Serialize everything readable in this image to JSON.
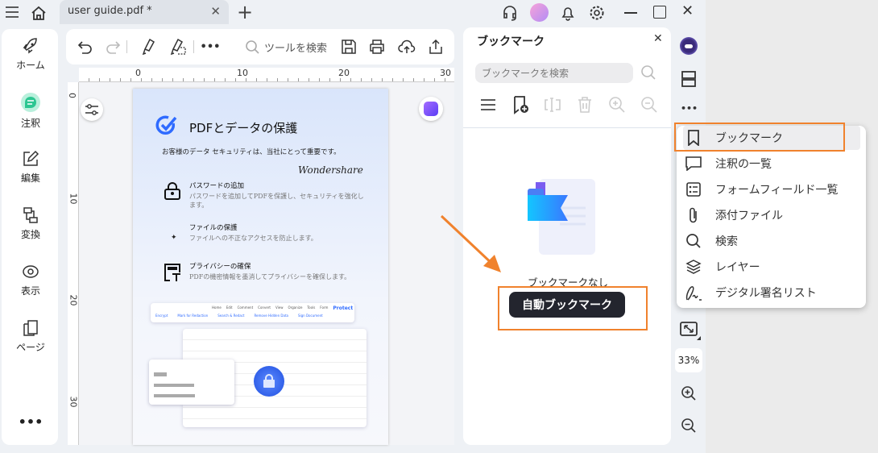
{
  "titlebar": {
    "tab_title": "user guide.pdf *"
  },
  "sidebar": {
    "items": [
      {
        "label": "ホーム"
      },
      {
        "label": "注釈"
      },
      {
        "label": "編集"
      },
      {
        "label": "変換"
      },
      {
        "label": "表示"
      },
      {
        "label": "ページ"
      }
    ]
  },
  "toolbar": {
    "search_placeholder": "ツールを検索"
  },
  "ruler": {
    "h_ticks": [
      "0",
      "10",
      "20",
      "30"
    ],
    "v_ticks": [
      "0",
      "10",
      "20",
      "30"
    ]
  },
  "document": {
    "title": "PDFとデータの保護",
    "subtitle": "お客様のデータ セキュリティは、当社にとって重要です。",
    "brand": "Wondershare",
    "features": [
      {
        "title": "パスワードの追加",
        "desc": "パスワードを追加してPDFを保護し、セキュリティを強化します。"
      },
      {
        "title": "ファイルの保護",
        "desc": "ファイルへの不正なアクセスを防止します。"
      },
      {
        "title": "プライバシーの確保",
        "desc": "PDFの機密情報を墨消してプライバシーを確保します。"
      }
    ],
    "mini_tabs": [
      "Home",
      "Edit",
      "Comment",
      "Convert",
      "View",
      "Organize",
      "Tools",
      "Form",
      "Protect"
    ],
    "mini_tools": [
      "Encrypt",
      "Mark for Redaction",
      "Search & Redact",
      "Remove Hidden Data",
      "Sign Document"
    ]
  },
  "bookmark_panel": {
    "title": "ブックマーク",
    "search_placeholder": "ブックマークを検索",
    "empty_text": "ブックマークなし",
    "auto_button": "自動ブックマーク"
  },
  "right_rail": {
    "zoom": "33%"
  },
  "menu": {
    "items": [
      {
        "label": "ブックマーク"
      },
      {
        "label": "注釈の一覧"
      },
      {
        "label": "フォームフィールド一覧"
      },
      {
        "label": "添付ファイル"
      },
      {
        "label": "検索"
      },
      {
        "label": "レイヤー"
      },
      {
        "label": "デジタル署名リスト"
      }
    ]
  },
  "colors": {
    "accent": "#f0822d",
    "dark_button": "#23252e",
    "protect_blue": "#2f6bff"
  }
}
